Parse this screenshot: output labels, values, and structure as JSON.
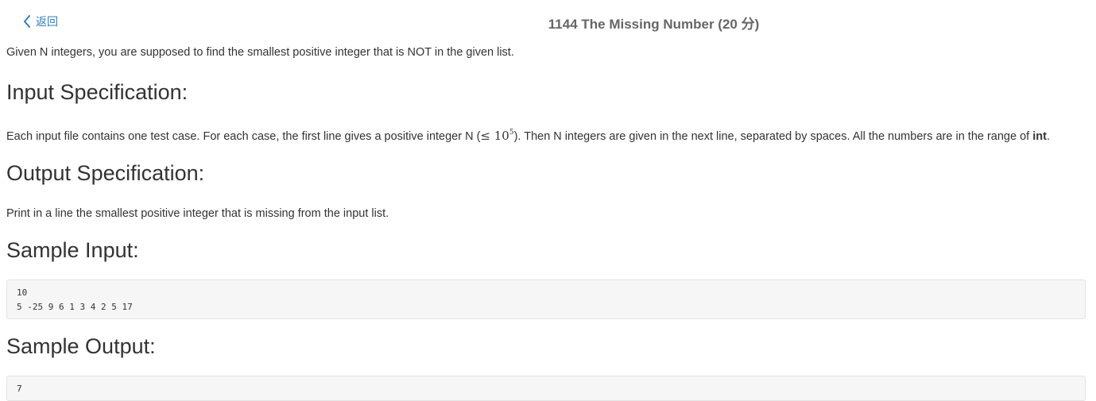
{
  "nav": {
    "back_label": "返回",
    "title": "1144 The Missing Number (20 分)"
  },
  "problem": {
    "description": "Given N integers, you are supposed to find the smallest positive integer that is NOT in the given list.",
    "input_heading": "Input Specification:",
    "input_text_before": "Each input file contains one test case. For each case, the first line gives a positive integer N (",
    "input_math_base": "≤ 10",
    "input_math_exp": "5",
    "input_text_after": "). Then N integers are given in the next line, separated by spaces. All the numbers are in the range of ",
    "input_text_bold": "int",
    "input_text_end": ".",
    "output_heading": "Output Specification:",
    "output_text": "Print in a line the smallest positive integer that is missing from the input list.",
    "sample_input_heading": "Sample Input:",
    "sample_input_lines": [
      "10",
      "5 -25 9 6 1 3 4 2 5 17"
    ],
    "sample_output_heading": "Sample Output:",
    "sample_output_lines": [
      "7"
    ]
  },
  "colors": {
    "link": "#2f7ec1",
    "title": "#666666",
    "text": "#333333",
    "code_bg": "#f6f6f6"
  }
}
